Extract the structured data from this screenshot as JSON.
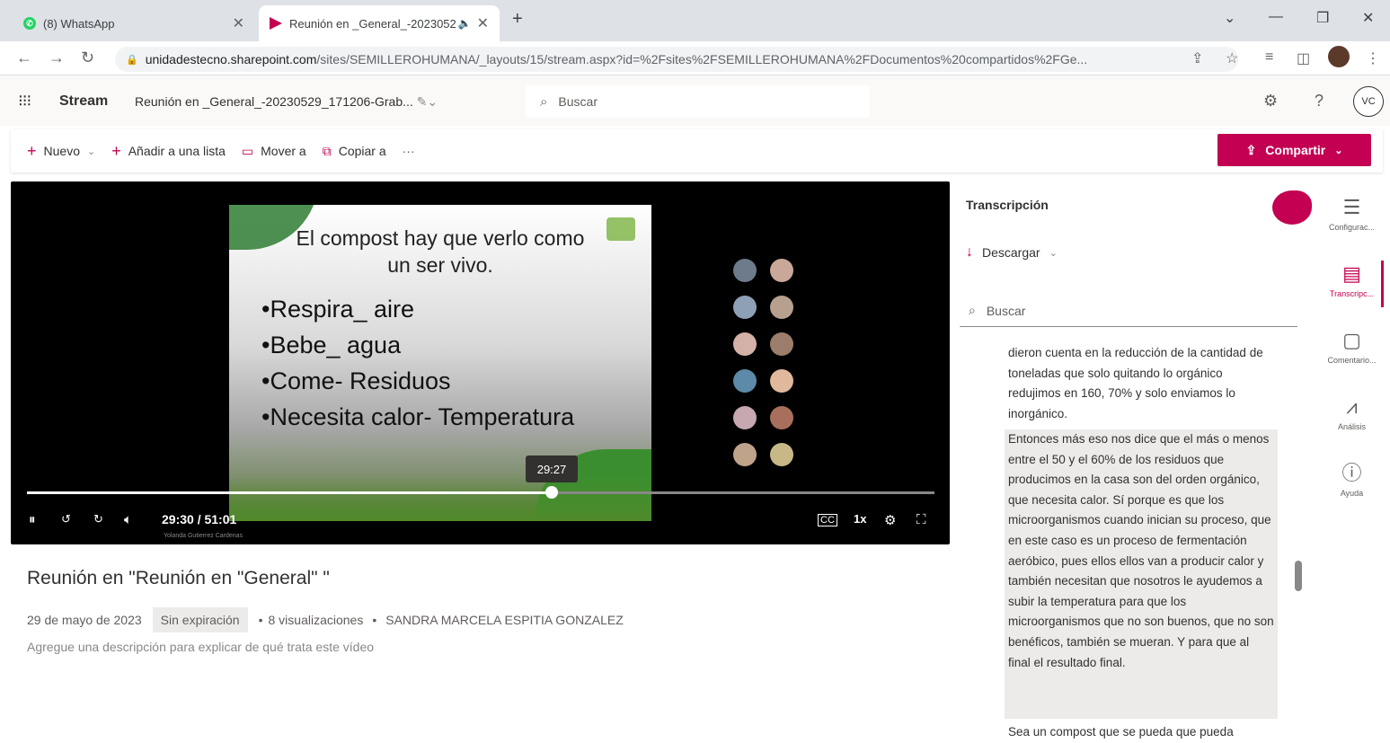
{
  "browser": {
    "tabs": [
      {
        "title": "(8) WhatsApp",
        "active": false
      },
      {
        "title": "Reunión en _General_-2023052",
        "active": true
      }
    ],
    "new_tab": "+",
    "url_host": "unidadestecno.sharepoint.com",
    "url_path": "/sites/SEMILLEROHUMANA/_layouts/15/stream.aspx?id=%2Fsites%2FSEMILLEROHUMANA%2FDocumentos%20compartidos%2FGe..."
  },
  "app": {
    "name": "Stream",
    "doc_title": "Reunión en _General_-20230529_171206-Grab...",
    "search_placeholder": "Buscar",
    "avatar": "VC"
  },
  "commands": {
    "new": "Nuevo",
    "add_to_list": "Añadir a una lista",
    "move_to": "Mover a",
    "copy_to": "Copiar a",
    "more": "···",
    "share": "Compartir"
  },
  "video": {
    "slide_title_line1": "El compost hay que verlo como",
    "slide_title_line2": "un ser vivo.",
    "slide_bullets": [
      "•Respira_ aire",
      "•Bebe_ agua",
      "•Come- Residuos",
      "•Necesita calor- Temperatura"
    ],
    "hover_time": "29:27",
    "time_display": "29:30 / 51:01",
    "progress": 0.578,
    "speaker_caption": "Yolanda Gutierrez Cardenas",
    "speed": "1x",
    "cc": "CC"
  },
  "info": {
    "title": "Reunión en \"Reunión en \"General\" \"",
    "date": "29 de mayo de 2023",
    "expiration": "Sin expiración",
    "views": "8 visualizaciones",
    "owner": "SANDRA MARCELA ESPITIA GONZALEZ",
    "description_placeholder": "Agregue una descripción para explicar de qué trata este vídeo"
  },
  "transcript": {
    "heading": "Transcripción",
    "download": "Descargar",
    "search_placeholder": "Buscar",
    "block1": "dieron cuenta en la reducción de la cantidad de toneladas que solo quitando lo orgánico redujimos en 160, 70% y solo enviamos lo inorgánico.",
    "block2": "Entonces más eso nos dice que el más o menos entre el 50 y el 60% de los residuos que producimos en la casa son del orden orgánico, que necesita calor. Sí porque es que los microorganismos cuando inician su proceso, que en este caso es un proceso de fermentación aeróbico, pues ellos ellos van a producir calor y también necesitan que nosotros le ayudemos a subir la temperatura para que los microorganismos que no son buenos, que no son benéficos, también se mueran. Y para que al final el resultado final.",
    "block3": "Sea un compost que se pueda que pueda"
  },
  "rail": {
    "items": [
      {
        "label": "Configurac...",
        "icon": "settings-panel-icon"
      },
      {
        "label": "Transcripc...",
        "icon": "transcript-icon",
        "active": true
      },
      {
        "label": "Comentario...",
        "icon": "comment-icon"
      },
      {
        "label": "Análisis",
        "icon": "analytics-icon"
      },
      {
        "label": "Ayuda",
        "icon": "help-icon"
      }
    ]
  },
  "colors": {
    "accent": "#c30052",
    "player_bg": "#000000"
  }
}
